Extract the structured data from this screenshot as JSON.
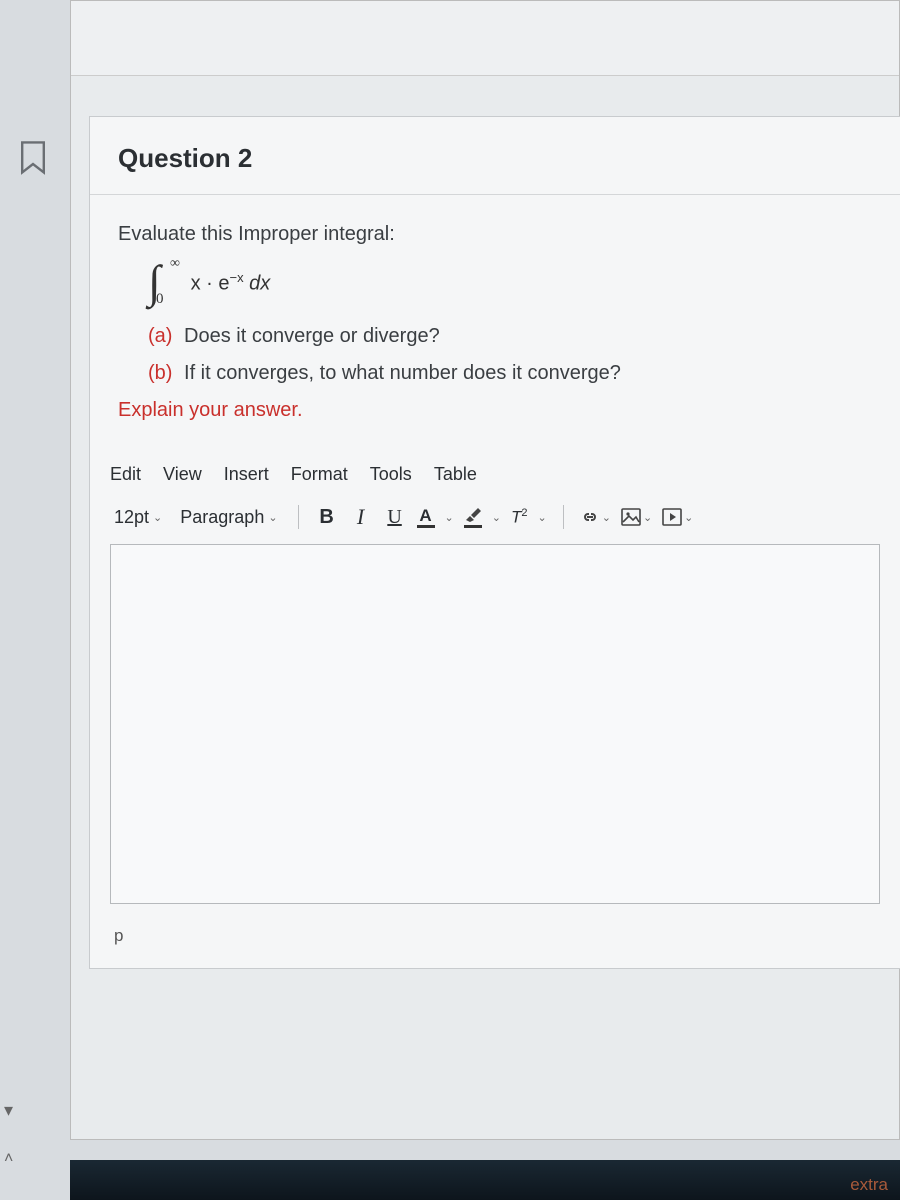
{
  "question": {
    "title": "Question 2",
    "prompt": "Evaluate this Improper integral:",
    "integral_upper": "∞",
    "integral_lower": "0",
    "integrand_text": "x·e⁻ˣ dx",
    "part_a_label": "(a)",
    "part_a_text": "Does it converge or diverge?",
    "part_b_label": "(b)",
    "part_b_text": "If it converges, to what number does it converge?",
    "explain": "Explain your answer."
  },
  "editor": {
    "menus": [
      "Edit",
      "View",
      "Insert",
      "Format",
      "Tools",
      "Table"
    ],
    "font_size": "12pt",
    "style": "Paragraph",
    "status": "p"
  },
  "toolbar": {
    "bold": "B",
    "italic": "I",
    "underline": "U",
    "textcolor": "A",
    "super_tool": "T²"
  },
  "footer_text": "extra"
}
